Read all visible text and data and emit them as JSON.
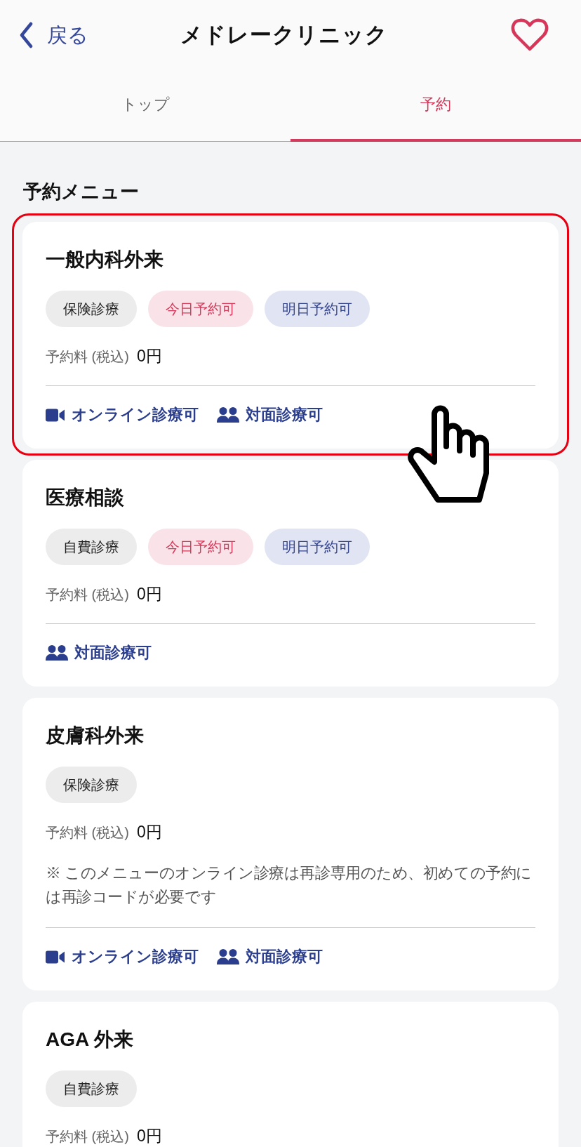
{
  "header": {
    "back": "戻る",
    "title": "メドレークリニック"
  },
  "tabs": [
    {
      "label": "トップ",
      "selected": false
    },
    {
      "label": "予約",
      "selected": true
    }
  ],
  "section_title": "予約メニュー",
  "menus": [
    {
      "title": "一般内科外来",
      "highlighted": true,
      "badges": [
        {
          "kind": "coverage",
          "label": "保険診療"
        },
        {
          "kind": "today",
          "label": "今日予約可"
        },
        {
          "kind": "tomorrow",
          "label": "明日予約可"
        }
      ],
      "fee_label": "予約料 (税込)",
      "fee": "0円",
      "features": [
        {
          "kind": "online",
          "label": "オンライン診療可"
        },
        {
          "kind": "in_person",
          "label": "対面診療可"
        }
      ]
    },
    {
      "title": "医療相談",
      "highlighted": false,
      "badges": [
        {
          "kind": "coverage",
          "label": "自費診療"
        },
        {
          "kind": "today",
          "label": "今日予約可"
        },
        {
          "kind": "tomorrow",
          "label": "明日予約可"
        }
      ],
      "fee_label": "予約料 (税込)",
      "fee": "0円",
      "features": [
        {
          "kind": "in_person",
          "label": "対面診療可"
        }
      ]
    },
    {
      "title": "皮膚科外来",
      "highlighted": false,
      "badges": [
        {
          "kind": "coverage",
          "label": "保険診療"
        }
      ],
      "fee_label": "予約料 (税込)",
      "fee": "0円",
      "note": "※ このメニューのオンライン診療は再診専用のため、初めての予約には再診コードが必要です",
      "features": [
        {
          "kind": "online",
          "label": "オンライン診療可"
        },
        {
          "kind": "in_person",
          "label": "対面診療可"
        }
      ]
    },
    {
      "title": "AGA 外来",
      "highlighted": false,
      "badges": [
        {
          "kind": "coverage",
          "label": "自費診療"
        }
      ],
      "fee_label": "予約料 (税込)",
      "fee": "0円"
    }
  ]
}
